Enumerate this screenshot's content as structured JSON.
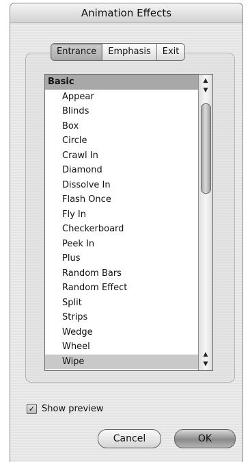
{
  "window": {
    "title": "Animation Effects"
  },
  "tabs": [
    {
      "label": "Entrance",
      "selected": true
    },
    {
      "label": "Emphasis",
      "selected": false
    },
    {
      "label": "Exit",
      "selected": false
    }
  ],
  "effects_list": {
    "category": "Basic",
    "items": [
      "Appear",
      "Blinds",
      "Box",
      "Circle",
      "Crawl In",
      "Diamond",
      "Dissolve In",
      "Flash Once",
      "Fly In",
      "Checkerboard",
      "Peek In",
      "Plus",
      "Random Bars",
      "Random Effect",
      "Split",
      "Strips",
      "Wedge",
      "Wheel",
      "Wipe"
    ],
    "selected_item": "Wipe"
  },
  "scroll_icons": {
    "up": "triangle-up-icon",
    "down": "triangle-down-icon"
  },
  "show_preview": {
    "label": "Show preview",
    "checked": true
  },
  "buttons": {
    "cancel": "Cancel",
    "ok": "OK"
  }
}
